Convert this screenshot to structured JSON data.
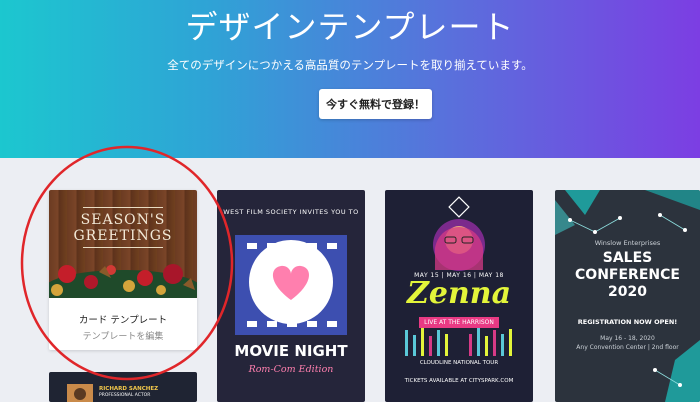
{
  "hero": {
    "title": "デザインテンプレート",
    "subtitle": "全てのデザインにつかえる高品質のテンプレートを取り揃えています。",
    "cta_label": "今すぐ無料で登録！"
  },
  "cards": [
    {
      "image_text_line1": "SEASON'S",
      "image_text_line2": "GREETINGS",
      "title": "カード テンプレート",
      "subtitle": "テンプレートを編集"
    },
    {
      "top_text": "WEST FILM SOCIETY INVITES YOU TO",
      "title": "MOVIE NIGHT",
      "subtitle": "Rom-Com Edition"
    },
    {
      "dates": "MAY 15 | MAY 16 | MAY 18",
      "title": "Zenna",
      "live": "LIVE AT THE HARRISON",
      "tour": "CLOUDLINE NATIONAL TOUR",
      "tickets": "TICKETS AVAILABLE AT CITYSPARK.COM"
    },
    {
      "company": "Winslow Enterprises",
      "title_line1": "SALES",
      "title_line2": "CONFERENCE",
      "title_line3": "2020",
      "registration": "REGISTRATION NOW OPEN!",
      "dates": "May 16 - 18, 2020",
      "venue": "Any Convention Center | 2nd floor"
    },
    {
      "name": "RICHARD SANCHEZ",
      "role": "PROFESSIONAL ACTOR"
    }
  ],
  "colors": {
    "hero_gradient_start": "#1cc7cf",
    "hero_gradient_end": "#7c3ee3",
    "highlight_circle": "#e0262a",
    "page_bg": "#eceef3"
  }
}
